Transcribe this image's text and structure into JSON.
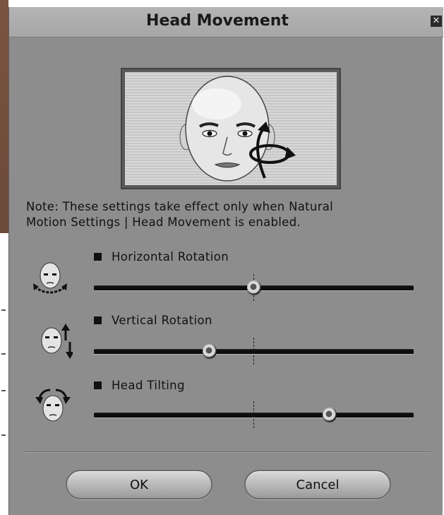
{
  "dialog": {
    "title": "Head Movement",
    "close_icon": "close-icon"
  },
  "note": {
    "line1": "Note: These settings take effect only when Natural",
    "line2": "Motion Settings | Head Movement is enabled."
  },
  "controls": [
    {
      "label": "Horizontal Rotation",
      "icon": "head-horizontal-rotation-icon",
      "value_fraction": 0.5
    },
    {
      "label": "Vertical Rotation",
      "icon": "head-vertical-rotation-icon",
      "value_fraction": 0.36
    },
    {
      "label": "Head Tilting",
      "icon": "head-tilting-icon",
      "value_fraction": 0.74
    }
  ],
  "buttons": {
    "ok": "OK",
    "cancel": "Cancel"
  },
  "colors": {
    "dialog_bg": "#8d8d8d",
    "titlebar_bg": "#acacac",
    "track": "#0e0e0e"
  }
}
